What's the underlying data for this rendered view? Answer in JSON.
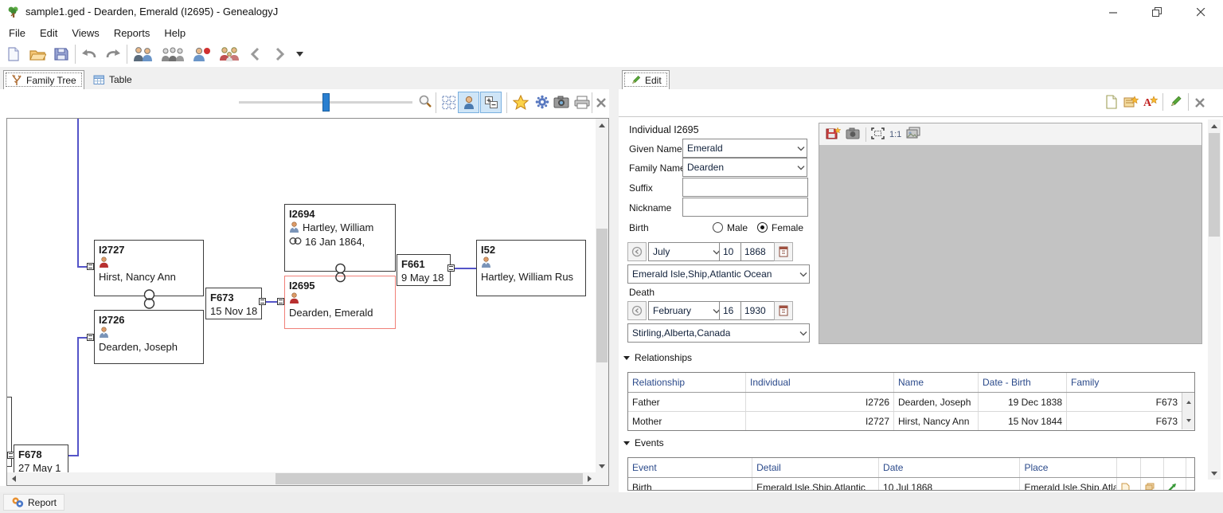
{
  "window": {
    "title": "sample1.ged - Dearden, Emerald (I2695) - GenealogyJ"
  },
  "menu": {
    "items": [
      "File",
      "Edit",
      "Views",
      "Reports",
      "Help"
    ]
  },
  "tabs": {
    "family_tree": "Family Tree",
    "table": "Table",
    "edit": "Edit",
    "report": "Report"
  },
  "tree": {
    "boxes": {
      "i2727": {
        "id": "I2727",
        "name": "Hirst, Nancy Ann",
        "sex": "female"
      },
      "i2726": {
        "id": "I2726",
        "name": "Dearden, Joseph",
        "sex": "male"
      },
      "f673": {
        "id": "F673",
        "date": "15 Nov 18"
      },
      "i2694": {
        "id": "I2694",
        "name": "Hartley, William",
        "date": "16 Jan 1864,",
        "sex": "male"
      },
      "i2695": {
        "id": "I2695",
        "name": "Dearden, Emerald",
        "sex": "female",
        "selected": true
      },
      "f661": {
        "id": "F661",
        "date": "9 May 18"
      },
      "i52": {
        "id": "I52",
        "name": "Hartley, William Rus",
        "sex": "male"
      },
      "f678": {
        "id": "F678",
        "date": "27 May 1"
      }
    }
  },
  "edit": {
    "individual_label": "Individual I2695",
    "given_name": {
      "label": "Given Name",
      "value": "Emerald"
    },
    "family_name": {
      "label": "Family Name",
      "value": "Dearden"
    },
    "suffix": {
      "label": "Suffix",
      "value": ""
    },
    "nickname": {
      "label": "Nickname",
      "value": ""
    },
    "sex": {
      "male": "Male",
      "female": "Female",
      "selected": "Female"
    },
    "birth": {
      "label": "Birth",
      "month": "July",
      "day": "10",
      "year": "1868",
      "place": "Emerald Isle,Ship,Atlantic Ocean"
    },
    "death": {
      "label": "Death",
      "month": "February",
      "day": "16",
      "year": "1930",
      "place": "Stirling,Alberta,Canada"
    },
    "media": {
      "zoom_label": "1:1"
    }
  },
  "relationships": {
    "title": "Relationships",
    "columns": [
      "Relationship",
      "Individual",
      "Name",
      "Date - Birth",
      "Family"
    ],
    "rows": [
      [
        "Father",
        "I2726",
        "Dearden, Joseph",
        "19 Dec 1838",
        "F673"
      ],
      [
        "Mother",
        "I2727",
        "Hirst, Nancy Ann",
        "15 Nov 1844",
        "F673"
      ]
    ]
  },
  "events": {
    "title": "Events",
    "columns": [
      "Event",
      "Detail",
      "Date",
      "Place"
    ],
    "rows": [
      [
        "Birth",
        "Emerald Isle,Ship,Atlantic",
        "10 Jul 1868",
        "Emerald Isle,Ship,Atlantic"
      ]
    ]
  },
  "icons": {
    "source_letter": "A"
  },
  "colors": {
    "connector_blue": "#5454c8",
    "selected_box_border": "#f08078",
    "slider_handle": "#2a7fd0",
    "toggle_background": "#cfe5f7",
    "table_header_text": "#2b4a8b"
  }
}
